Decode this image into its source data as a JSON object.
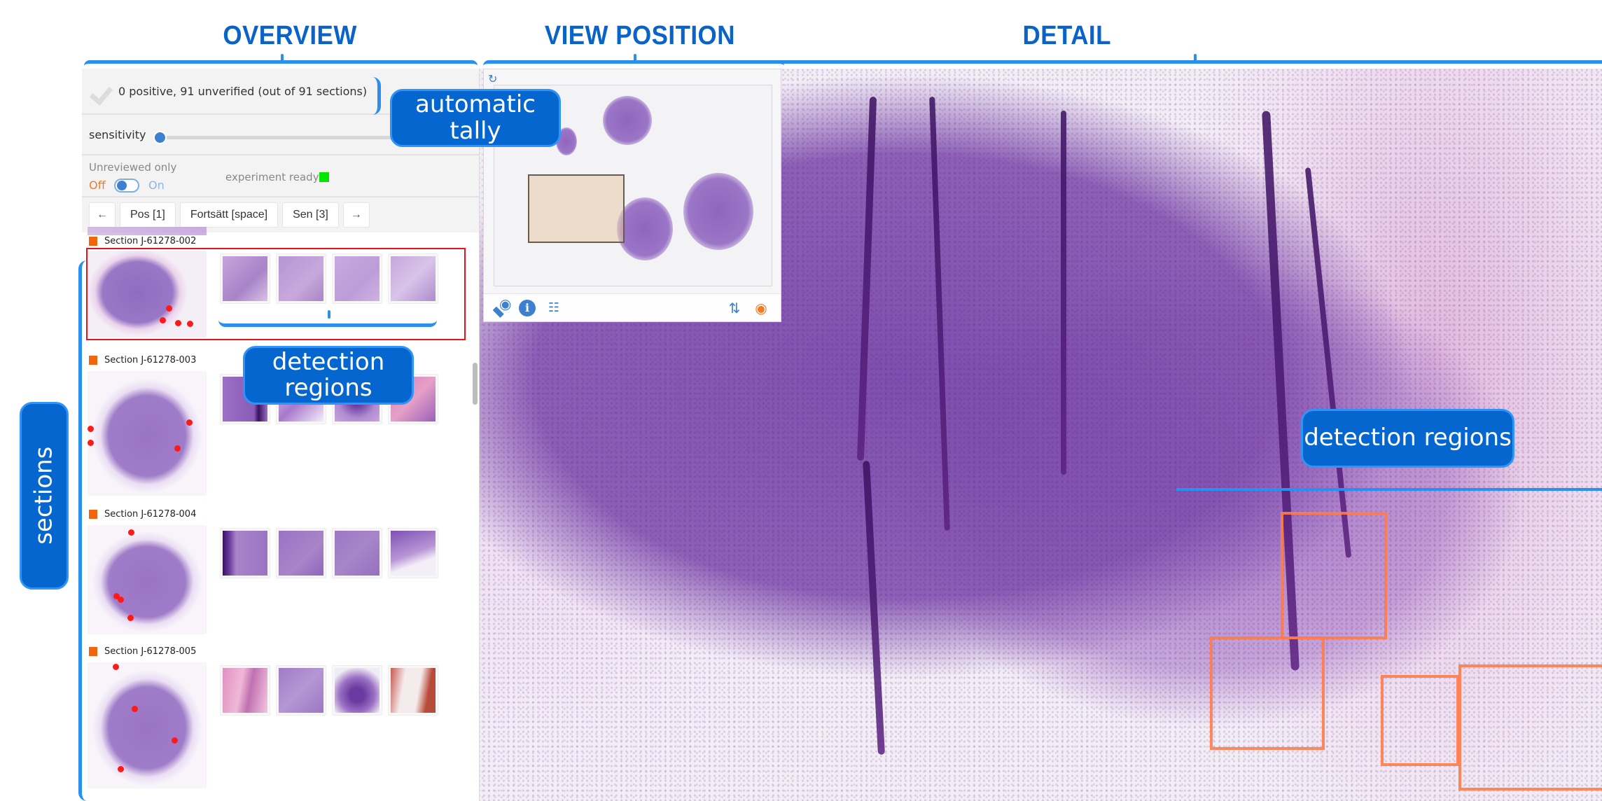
{
  "annotations": {
    "overview": "OVERVIEW",
    "view_position": "VIEW POSITION",
    "detail": "DETAIL",
    "automatic_tally_line1": "automatic",
    "automatic_tally_line2": "tally",
    "detection_regions_sidebar_line1": "detection",
    "detection_regions_sidebar_line2": "regions",
    "detection_regions_detail": "detection regions",
    "sections": "sections"
  },
  "sidebar": {
    "tally_text": "0 positive, 91 unverified (out of 91 sections)",
    "tally_icon": "check-icon",
    "sensitivity_label": "sensitivity",
    "sensitivity_value": 0,
    "unreviewed_label": "Unreviewed only",
    "toggle_off": "Off",
    "toggle_on": "On",
    "toggle_state": "off",
    "experiment_status": "experiment ready",
    "experiment_status_color": "#00e600",
    "nav": {
      "prev": "←",
      "pos": "Pos [1]",
      "continue": "Fortsätt [space]",
      "later": "Sen [3]",
      "next": "→"
    },
    "sections": [
      {
        "title": "Section J-61278-002",
        "flag_color": "#f0650e",
        "selected": true,
        "patch_count": 4
      },
      {
        "title": "Section J-61278-003",
        "flag_color": "#f0650e",
        "selected": false,
        "patch_count": 4
      },
      {
        "title": "Section J-61278-004",
        "flag_color": "#f0650e",
        "selected": false,
        "patch_count": 4
      },
      {
        "title": "Section J-61278-005",
        "flag_color": "#f0650e",
        "selected": false,
        "patch_count": 4
      }
    ]
  },
  "minimap": {
    "icons": [
      "rotate-icon",
      "slide-label-icon",
      "info-icon",
      "settings-sliders-icon",
      "flip-icon",
      "visibility-icon"
    ]
  },
  "colors": {
    "accent": "#0666d0",
    "annotation_line": "#2b8ff0",
    "detection_box": "#ff7b4a",
    "selected_frame": "#e8121a",
    "marker_dot": "#ff1a1a"
  }
}
